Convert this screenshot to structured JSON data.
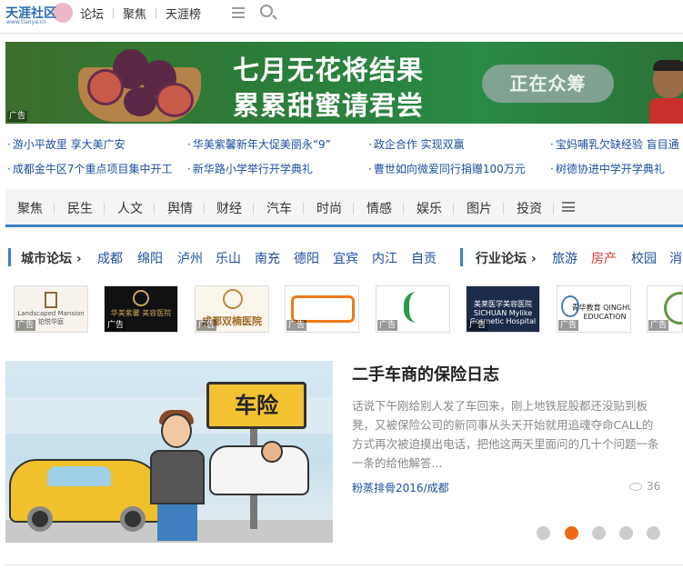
{
  "header": {
    "logo_text": "天涯社区",
    "logo_url": "www.tianya.cn",
    "nav": [
      "论坛",
      "聚焦",
      "天涯榜"
    ]
  },
  "banner": {
    "line1": "七月无花将结果",
    "line2": "累累甜蜜请君尝",
    "button": "正在众筹",
    "ad_label": "广告"
  },
  "news_links": [
    "游小平故里 享大美广安",
    "华美紫馨新年大促美丽永“9”",
    "政企合作 实现双赢",
    "宝妈哺乳欠缺经验 盲目通",
    "成都金牛区7个重点项目集中开工",
    "新华路小学举行开学典礼",
    "曹世如向微爱同行捐赠100万元",
    "树德协进中学开学典礼"
  ],
  "categories": [
    "聚焦",
    "民生",
    "人文",
    "舆情",
    "财经",
    "汽车",
    "时尚",
    "情感",
    "娱乐",
    "图片",
    "投资"
  ],
  "city_forum": {
    "heading": "城市论坛",
    "cities": [
      "成都",
      "绵阳",
      "泸州",
      "乐山",
      "南充",
      "德阳",
      "宜宾",
      "内江",
      "自贡"
    ]
  },
  "industry_forum": {
    "heading": "行业论坛",
    "items": [
      "旅游",
      "房产",
      "校园",
      "消"
    ],
    "highlight_color": "#d43a2f"
  },
  "logo_ads": [
    {
      "name": "Landscaped Mansion 铂悦华庭",
      "ad": "广告"
    },
    {
      "name": "华美紫馨 美容医院",
      "ad": "广告"
    },
    {
      "name": "成都双楠医院",
      "ad": "广告"
    },
    {
      "name": "",
      "ad": "广告"
    },
    {
      "name": "",
      "ad": "广告"
    },
    {
      "name": "美莱医学美容医院 SICHUAN Mylike Cosmetic Hospital",
      "ad": "广告"
    },
    {
      "name": "青华教育 QINGHUA EDUCATION",
      "ad": "广告"
    },
    {
      "name": "",
      "ad": "广告"
    }
  ],
  "article": {
    "image_sign": "车险",
    "title": "二手车商的保险日志",
    "description": "话说下午刚给别人发了车回来，刚上地铁屁股都还没贴到板凳，又被保险公司的新同事从头天开始就用追魂夺命CALL的方式再次被迫摸出电话，把他这两天里面问的几十个问题一条一条的给他解答...",
    "author": "粉蒸排骨2016/成都",
    "views": "36",
    "carousel_total": 5,
    "carousel_active": 2
  },
  "colors": {
    "link": "#1c4fa0",
    "accent": "#3c7ec4",
    "active_dot": "#ee6a12"
  }
}
